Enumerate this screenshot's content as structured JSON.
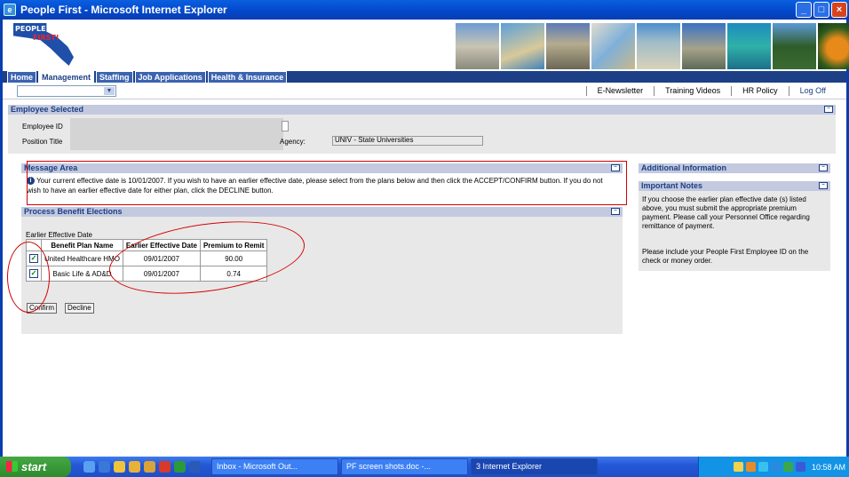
{
  "window": {
    "title": "People First - Microsoft Internet Explorer"
  },
  "logo": {
    "line1": "PEOPLE",
    "line2": "FIRST!"
  },
  "nav": {
    "tabs": [
      {
        "label": "Home"
      },
      {
        "label": "Management",
        "active": true
      },
      {
        "label": "Staffing"
      },
      {
        "label": "Job Applications"
      },
      {
        "label": "Health & Insurance"
      }
    ]
  },
  "toplinks": {
    "enewsletter": "E-Newsletter",
    "training": "Training Videos",
    "hrpolicy": "HR Policy",
    "logoff": "Log Off"
  },
  "employee": {
    "title": "Employee Selected",
    "id_label": "Employee ID",
    "position_label": "Position Title",
    "agency_label": "Agency:",
    "agency_value": "UNIV - State Universities"
  },
  "message": {
    "title": "Message Area",
    "text": "Your current effective date is 10/01/2007. If you wish to have an earlier effective date, please select from the plans below and then click the ACCEPT/CONFIRM button. If you do not wish to have an earlier effective date for either plan, click the DECLINE button."
  },
  "process": {
    "title": "Process Benefit Elections",
    "table_caption": "Earlier Effective Date",
    "headers": [
      "",
      "Benefit Plan Name",
      "Earlier Effective Date",
      "Premium to Remit"
    ],
    "rows": [
      {
        "checked": true,
        "plan": "United Healthcare HMO",
        "date": "09/01/2007",
        "premium": "90.00"
      },
      {
        "checked": true,
        "plan": "Basic Life & AD&D",
        "date": "09/01/2007",
        "premium": "0.74"
      }
    ],
    "confirm_label": "Confirm",
    "decline_label": "Decline"
  },
  "additional": {
    "title": "Additional Information"
  },
  "notes": {
    "title": "Important Notes",
    "para1": "If you choose the earlier plan effective date (s) listed above, you must submit the appropriate premium payment. Please call your Personnel Office regarding remittance of payment.",
    "para2": "Please include your People First Employee ID on the check or money order."
  },
  "taskbar": {
    "start_label": "start",
    "tasks": [
      "Inbox - Microsoft Out...",
      "PF screen shots.doc -...",
      "3 Internet Explorer"
    ],
    "clock": "10:58 AM"
  },
  "colors": {
    "brand_blue": "#1c3f86",
    "panel_header": "#c3c9de",
    "panel_body": "#e8e8e8",
    "annotation_red": "#d40000"
  }
}
